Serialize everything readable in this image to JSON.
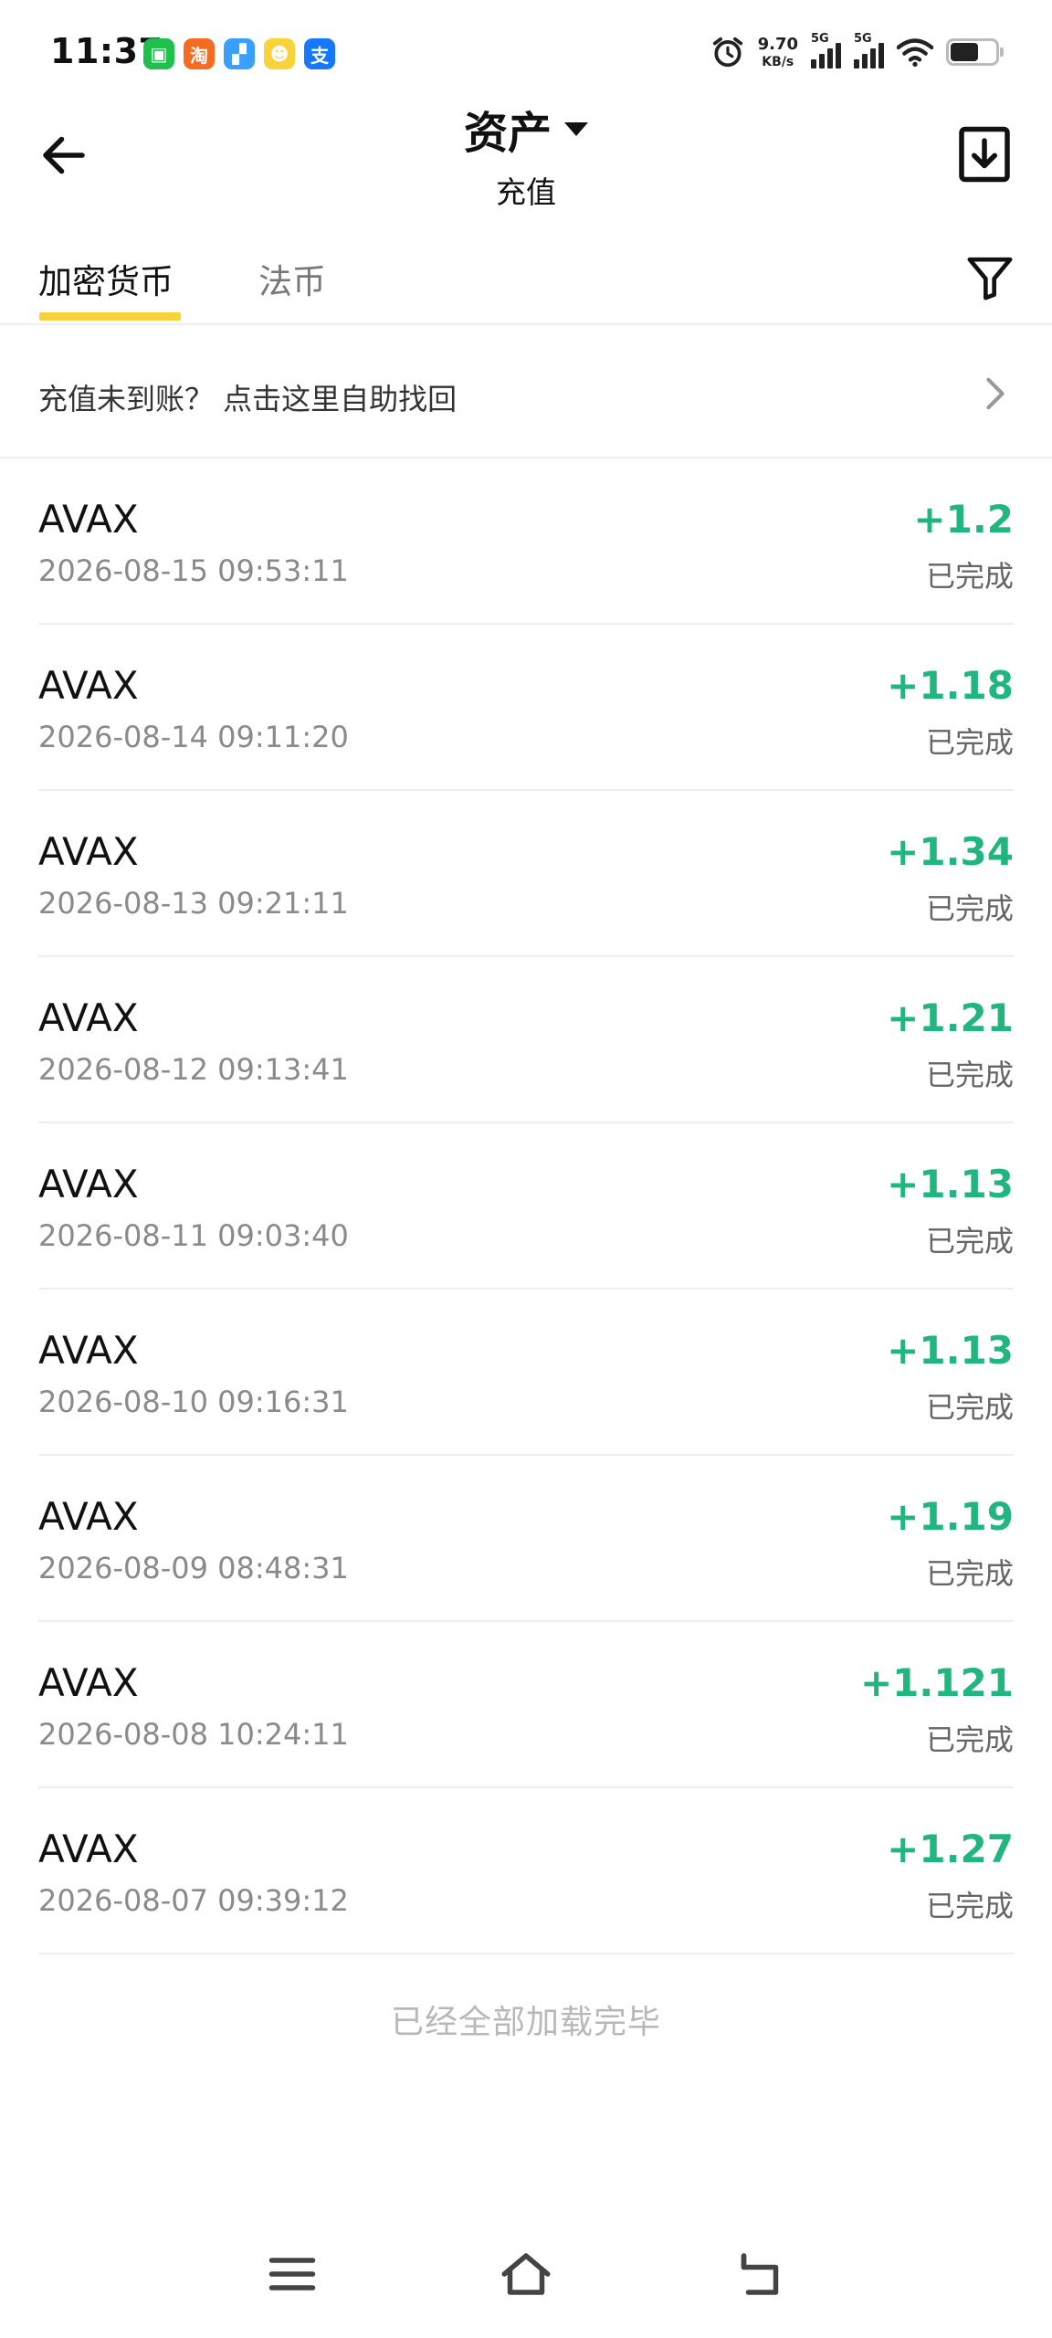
{
  "status_bar": {
    "time": "11:37",
    "apps": [
      {
        "name": "wechat-app-icon",
        "glyph": "▣",
        "color": "#1fc04e"
      },
      {
        "name": "taobao-app-icon",
        "glyph": "淘",
        "color": "#f36c21"
      },
      {
        "name": "cloud-app-icon",
        "glyph": "▞",
        "color": "#3aa0ff"
      },
      {
        "name": "meituan-app-icon",
        "glyph": "☻",
        "color": "#f8d33a"
      },
      {
        "name": "alipay-app-icon",
        "glyph": "支",
        "color": "#1677ff"
      }
    ],
    "net_speed_value": "9.70",
    "net_speed_unit": "KB/s",
    "signal1_label": "5G",
    "signal2_label": "5G"
  },
  "header": {
    "title": "资产",
    "subtitle": "充值"
  },
  "tabs": {
    "active": "加密货币",
    "inactive": "法币"
  },
  "notice": {
    "text": "充值未到账？ 点击这里自助找回"
  },
  "records": [
    {
      "coin": "AVAX",
      "datetime": "2026-08-15 09:53:11",
      "amount": "+1.2",
      "status": "已完成"
    },
    {
      "coin": "AVAX",
      "datetime": "2026-08-14 09:11:20",
      "amount": "+1.18",
      "status": "已完成"
    },
    {
      "coin": "AVAX",
      "datetime": "2026-08-13 09:21:11",
      "amount": "+1.34",
      "status": "已完成"
    },
    {
      "coin": "AVAX",
      "datetime": "2026-08-12 09:13:41",
      "amount": "+1.21",
      "status": "已完成"
    },
    {
      "coin": "AVAX",
      "datetime": "2026-08-11 09:03:40",
      "amount": "+1.13",
      "status": "已完成"
    },
    {
      "coin": "AVAX",
      "datetime": "2026-08-10 09:16:31",
      "amount": "+1.13",
      "status": "已完成"
    },
    {
      "coin": "AVAX",
      "datetime": "2026-08-09 08:48:31",
      "amount": "+1.19",
      "status": "已完成"
    },
    {
      "coin": "AVAX",
      "datetime": "2026-08-08 10:24:11",
      "amount": "+1.121",
      "status": "已完成"
    },
    {
      "coin": "AVAX",
      "datetime": "2026-08-07 09:39:12",
      "amount": "+1.27",
      "status": "已完成"
    }
  ],
  "end_text": "已经全部加载完毕",
  "colors": {
    "accent": "#f7d23a",
    "positive": "#21b57f"
  }
}
